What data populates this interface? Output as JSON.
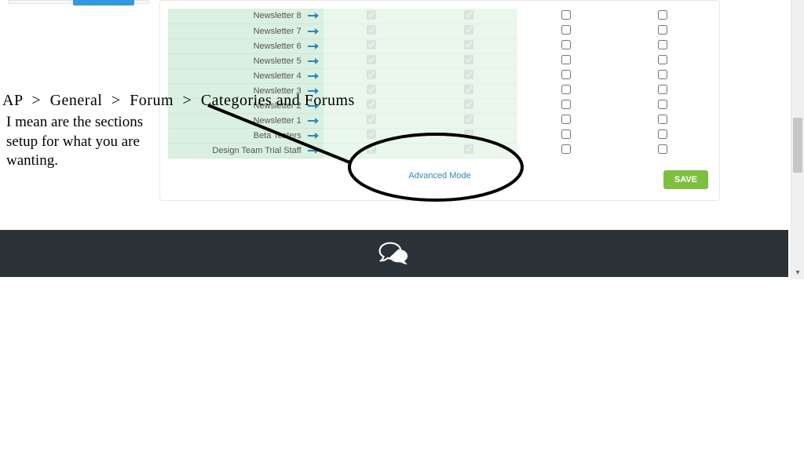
{
  "breadcrumb": [
    "AP",
    "General",
    "Forum",
    "Categories and Forums"
  ],
  "note": "I mean are the sections setup for what you are wanting.",
  "rows": [
    {
      "label": "Newsletter 8",
      "g1": true,
      "g2": true,
      "p1": false,
      "p2": false
    },
    {
      "label": "Newsletter 7",
      "g1": true,
      "g2": true,
      "p1": false,
      "p2": false
    },
    {
      "label": "Newsletter 6",
      "g1": true,
      "g2": true,
      "p1": false,
      "p2": false
    },
    {
      "label": "Newsletter 5",
      "g1": true,
      "g2": true,
      "p1": false,
      "p2": false
    },
    {
      "label": "Newsletter 4",
      "g1": true,
      "g2": true,
      "p1": false,
      "p2": false
    },
    {
      "label": "Newsletter 3",
      "g1": true,
      "g2": true,
      "p1": false,
      "p2": false
    },
    {
      "label": "Newsletter 2",
      "g1": true,
      "g2": true,
      "p1": false,
      "p2": false
    },
    {
      "label": "Newsletter 1",
      "g1": true,
      "g2": true,
      "p1": false,
      "p2": false
    },
    {
      "label": "Beta Testers",
      "g1": true,
      "g2": true,
      "p1": false,
      "p2": false
    },
    {
      "label": "Design Team Trial Staff",
      "g1": true,
      "g2": true,
      "p1": false,
      "p2": false
    }
  ],
  "advanced_mode_label": "Advanced Mode",
  "save_label": "SAVE"
}
